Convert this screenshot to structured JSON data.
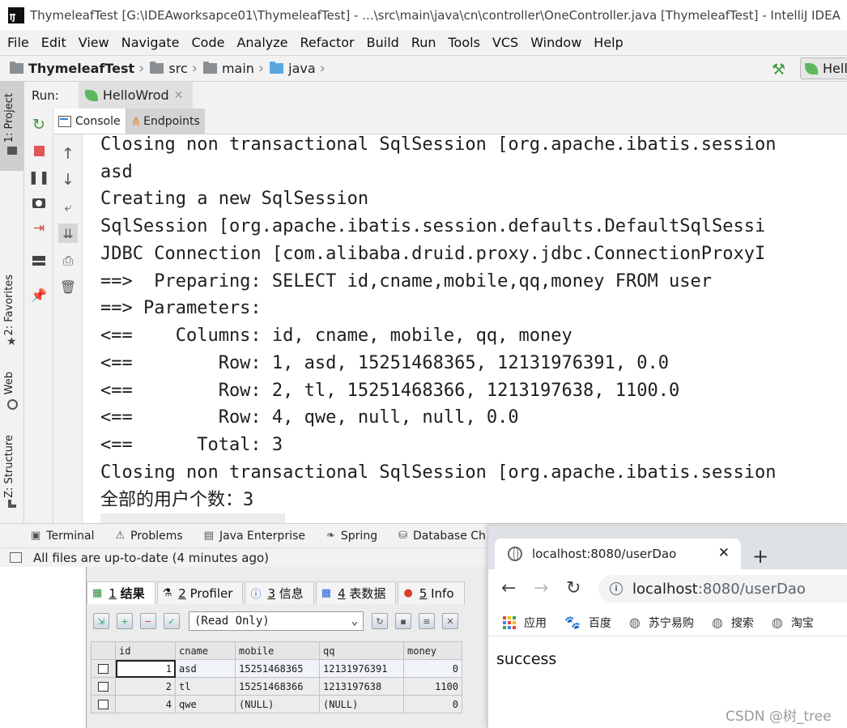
{
  "ide": {
    "title": "ThymeleafTest [G:\\IDEAworksapce01\\ThymeleafTest] - ...\\src\\main\\java\\cn\\controller\\OneController.java [ThymeleafTest] - IntelliJ IDEA",
    "menu": [
      "File",
      "Edit",
      "View",
      "Navigate",
      "Code",
      "Analyze",
      "Refactor",
      "Build",
      "Run",
      "Tools",
      "VCS",
      "Window",
      "Help"
    ],
    "breadcrumb": [
      "ThymeleafTest",
      "src",
      "main",
      "java"
    ],
    "run_config_label": "Hell",
    "left_stripe": {
      "project": "1: Project",
      "favorites": "2: Favorites",
      "web": "Web",
      "structure": "Z: Structure"
    },
    "run_panel": {
      "label": "Run:",
      "tab": "HelloWrod",
      "subtabs": [
        "Console",
        "Endpoints"
      ]
    },
    "console_lines": [
      "Closing non transactional SqlSession [org.apache.ibatis.session",
      "asd",
      "Creating a new SqlSession",
      "SqlSession [org.apache.ibatis.session.defaults.DefaultSqlSessi",
      "JDBC Connection [com.alibaba.druid.proxy.jdbc.ConnectionProxyI",
      "==>  Preparing: SELECT id,cname,mobile,qq,money FROM user",
      "==> Parameters: ",
      "<==    Columns: id, cname, mobile, qq, money",
      "<==        Row: 1, asd, 15251468365, 12131976391, 0.0",
      "<==        Row: 2, tl, 15251468366, 1213197638, 1100.0",
      "<==        Row: 4, qwe, null, null, 0.0",
      "<==      Total: 3",
      "Closing non transactional SqlSession [org.apache.ibatis.session",
      "全部的用户个数：3"
    ],
    "bottom_tabs": [
      "Terminal",
      "Problems",
      "Java Enterprise",
      "Spring",
      "Database Ch"
    ],
    "status": "All files are up-to-date (4 minutes ago)"
  },
  "db": {
    "tabs": [
      {
        "num": "1",
        "label": "结果"
      },
      {
        "num": "2",
        "label": "Profiler"
      },
      {
        "num": "3",
        "label": "信息"
      },
      {
        "num": "4",
        "label": "表数据"
      },
      {
        "num": "5",
        "label": "Info"
      }
    ],
    "mode": "(Read Only)",
    "columns": [
      "id",
      "cname",
      "mobile",
      "qq",
      "money"
    ],
    "rows": [
      [
        "1",
        "asd",
        "15251468365",
        "12131976391",
        "0"
      ],
      [
        "2",
        "tl",
        "15251468366",
        "1213197638",
        "1100"
      ],
      [
        "4",
        "qwe",
        "(NULL)",
        "(NULL)",
        "0"
      ]
    ]
  },
  "chrome": {
    "tab_title": "localhost:8080/userDao",
    "url_host": "localhost",
    "url_path": ":8080/userDao",
    "bookmarks": [
      "应用",
      "百度",
      "苏宁易购",
      "搜索",
      "淘宝"
    ],
    "body_text": "success"
  },
  "watermark": "CSDN @树_tree"
}
